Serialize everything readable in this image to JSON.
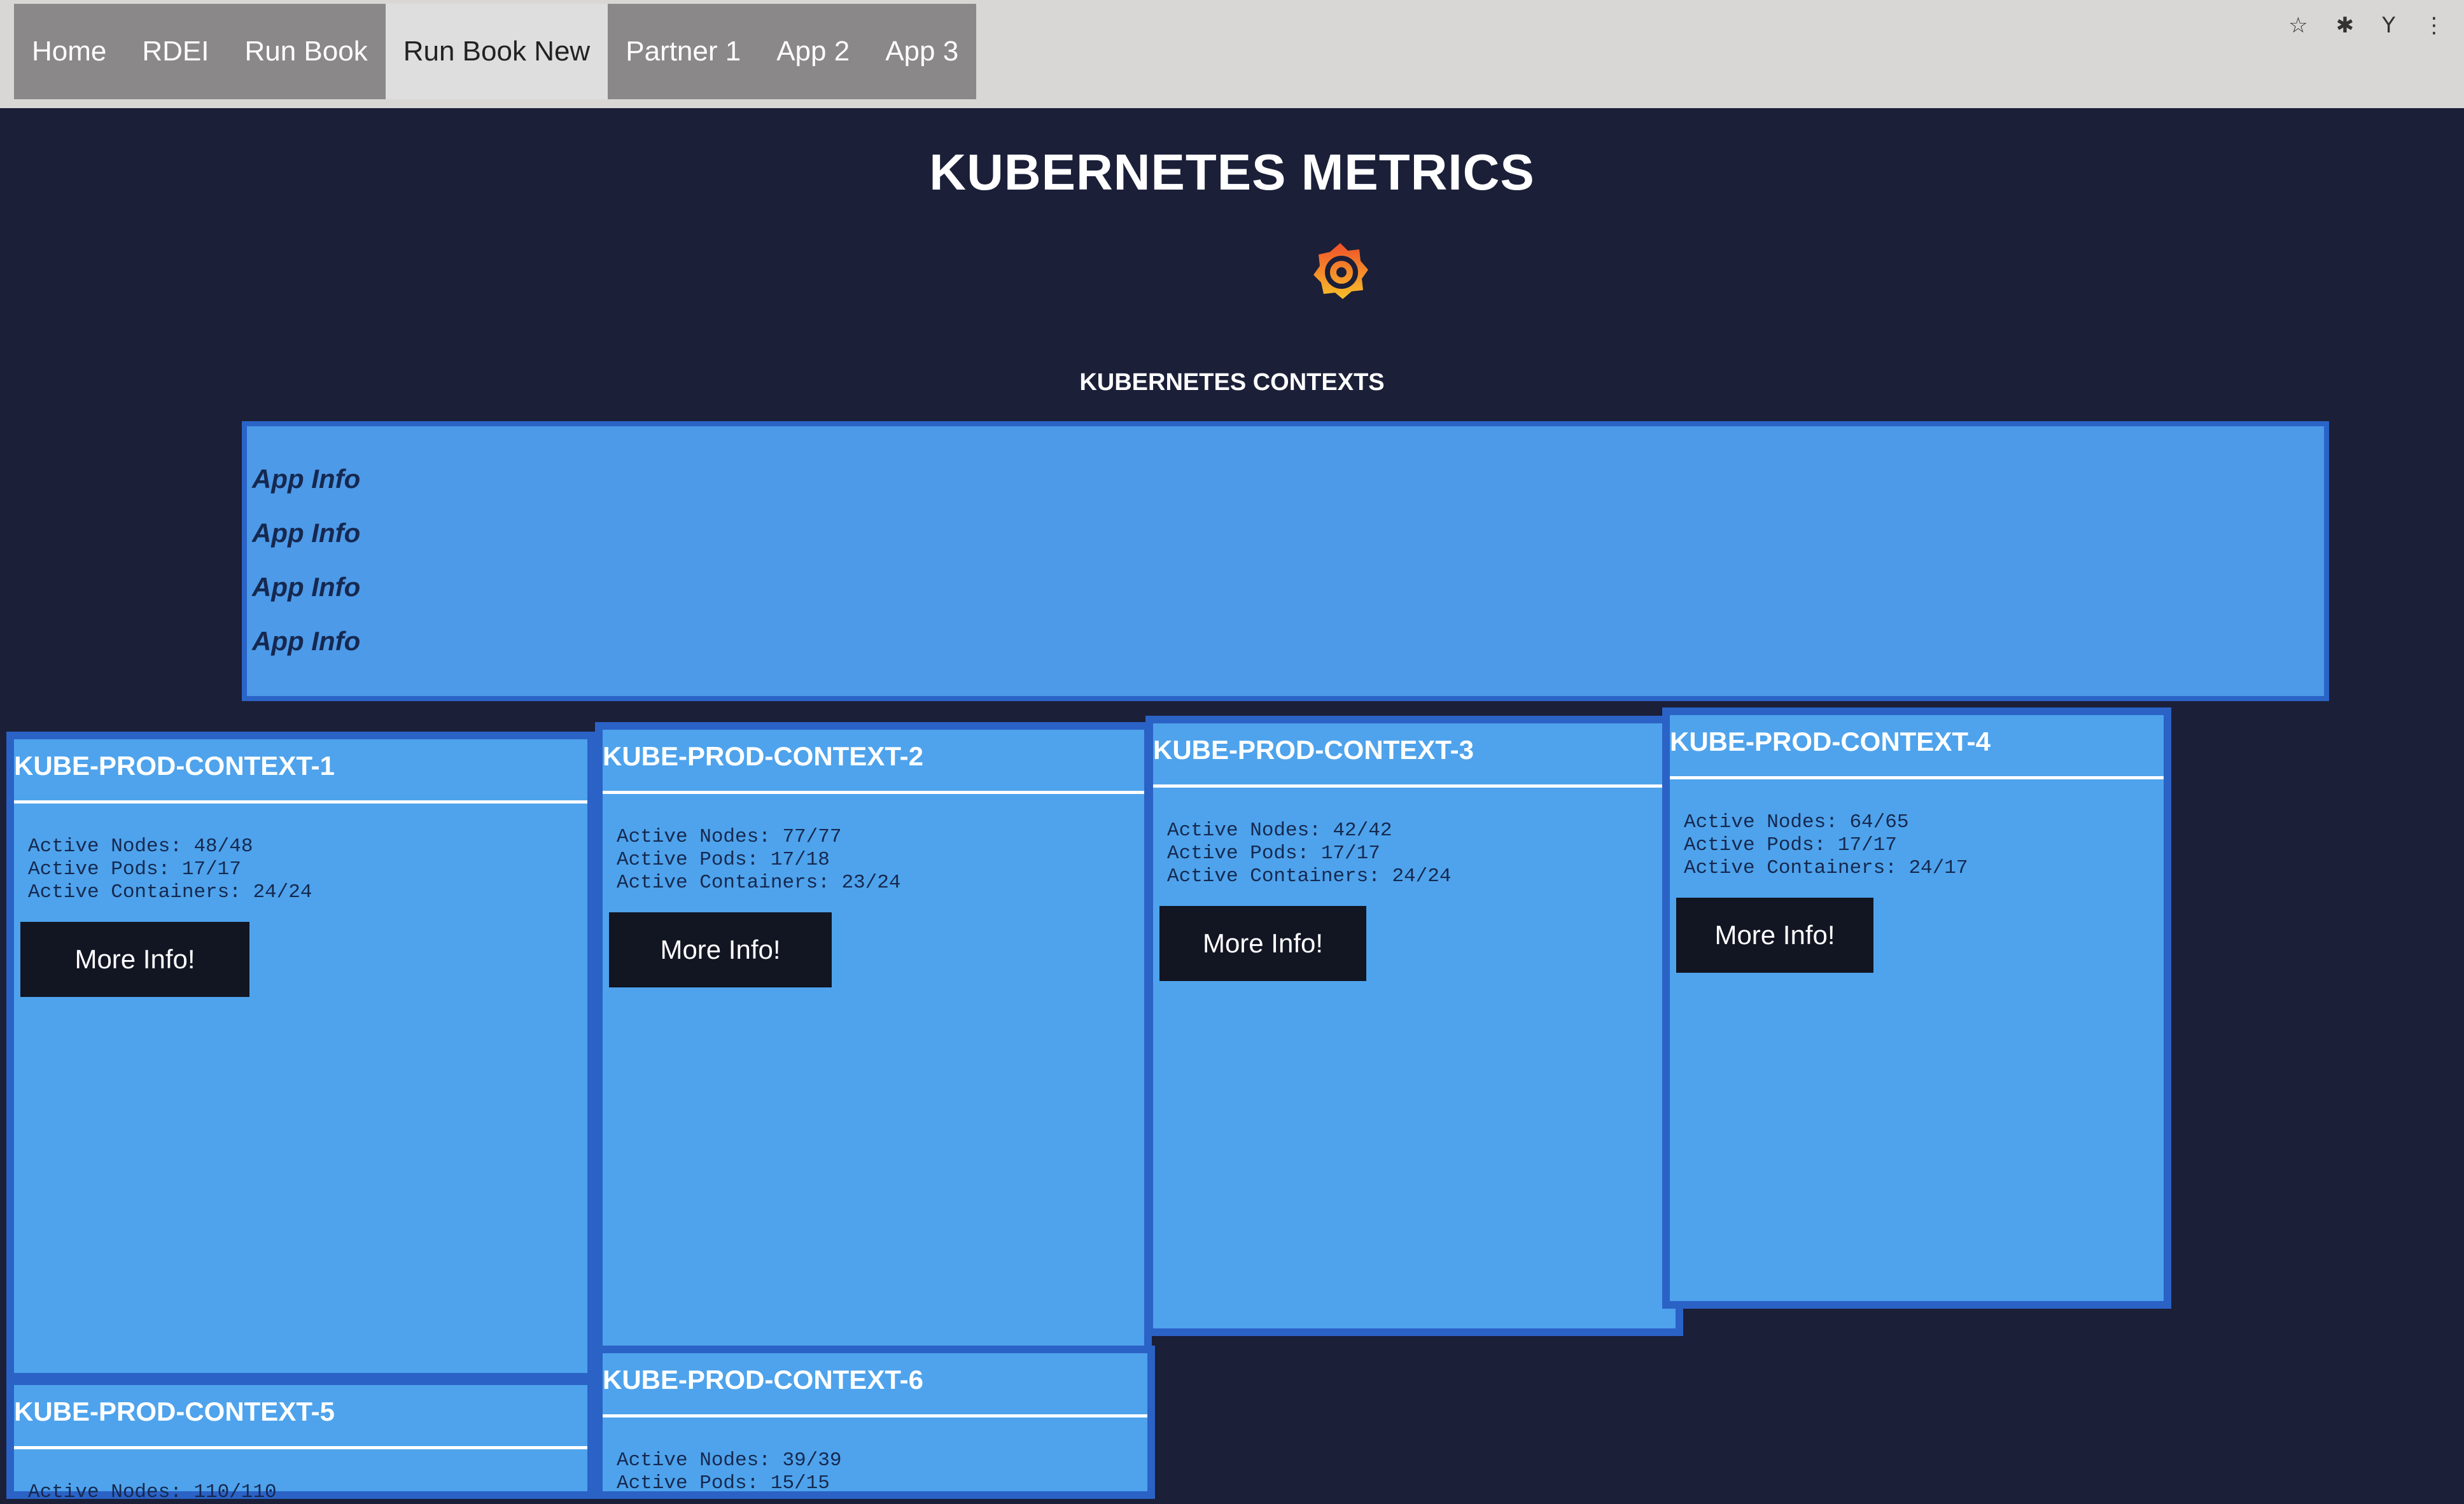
{
  "nav": {
    "items": [
      {
        "label": "Home"
      },
      {
        "label": "RDEI"
      },
      {
        "label": "Run Book"
      },
      {
        "label": "Run Book New"
      },
      {
        "label": "Partner 1"
      },
      {
        "label": "App 2"
      },
      {
        "label": "App 3"
      }
    ],
    "active_index": 3
  },
  "header": {
    "title": "KUBERNETES METRICS",
    "logo_icon": "grafana-logo-icon"
  },
  "contexts": {
    "title": "KUBERNETES CONTEXTS",
    "app_info": [
      "App Info",
      "App Info",
      "App Info",
      "App Info"
    ]
  },
  "cards": [
    {
      "name": "KUBE-PROD-CONTEXT-1",
      "nodes": "Active Nodes: 48/48",
      "pods": "Active Pods: 17/17",
      "containers": "Active Containers: 24/24",
      "button": "More Info!"
    },
    {
      "name": "KUBE-PROD-CONTEXT-2",
      "nodes": "Active Nodes: 77/77",
      "pods": "Active Pods: 17/18",
      "containers": "Active Containers: 23/24",
      "button": "More Info!"
    },
    {
      "name": "KUBE-PROD-CONTEXT-3",
      "nodes": "Active Nodes: 42/42",
      "pods": "Active Pods: 17/17",
      "containers": "Active Containers: 24/24",
      "button": "More Info!"
    },
    {
      "name": "KUBE-PROD-CONTEXT-4",
      "nodes": "Active Nodes: 64/65",
      "pods": "Active Pods: 17/17",
      "containers": "Active Containers: 24/17",
      "button": "More Info!"
    },
    {
      "name": "KUBE-PROD-CONTEXT-5",
      "nodes": "Active Nodes: 110/110",
      "pods": "",
      "containers": "",
      "button": ""
    },
    {
      "name": "KUBE-PROD-CONTEXT-6",
      "nodes": "Active Nodes: 39/39",
      "pods": "Active Pods: 15/15",
      "containers": "",
      "button": ""
    }
  ],
  "colors": {
    "background": "#1b1f38",
    "card": "#4ea3ec",
    "card_border": "#2b62c6",
    "button": "#121522"
  }
}
